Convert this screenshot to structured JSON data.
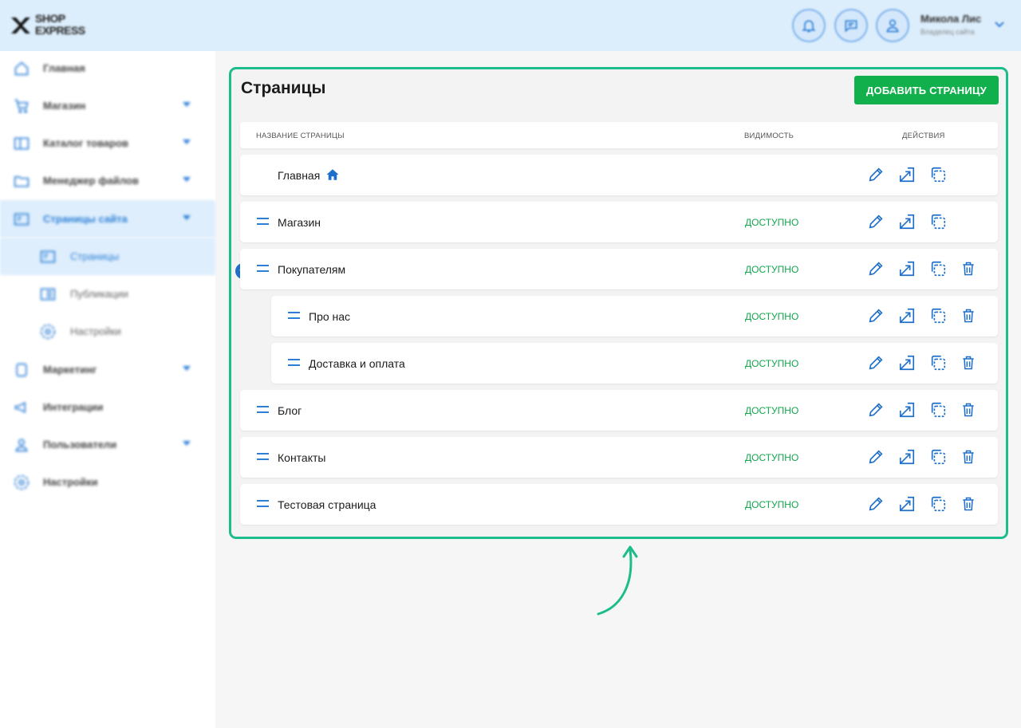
{
  "header": {
    "logo_line1": "SHOP",
    "logo_line2": "EXPRESS",
    "user_name": "Микола Лис",
    "user_role": "Владелец сайта",
    "icons": [
      "bell-icon",
      "chat-icon",
      "user-icon",
      "chevron-down-icon"
    ]
  },
  "sidebar": {
    "items": [
      {
        "label": "Главная",
        "icon": "home-icon"
      },
      {
        "label": "Магазин",
        "icon": "cart-icon"
      },
      {
        "label": "Каталог товаров",
        "icon": "catalog-icon"
      },
      {
        "label": "Менеджер файлов",
        "icon": "folder-icon"
      },
      {
        "label": "Страницы сайта",
        "icon": "pages-icon"
      },
      {
        "label": "Страницы",
        "icon": "page-icon"
      },
      {
        "label": "Публикации",
        "icon": "news-icon"
      },
      {
        "label": "Настройки",
        "icon": "gear-icon"
      },
      {
        "label": "Маркетинг",
        "icon": "marketing-icon"
      },
      {
        "label": "Интеграции",
        "icon": "megaphone-icon"
      },
      {
        "label": "Пользователи",
        "icon": "users-icon"
      },
      {
        "label": "Настройки",
        "icon": "gear-icon"
      }
    ]
  },
  "main": {
    "title": "Страницы",
    "add_button": "ДОБАВИТЬ СТРАНИЦУ",
    "columns": {
      "name": "НАЗВАНИЕ СТРАНИЦЫ",
      "visibility": "ВИДИМОСТЬ",
      "actions": "ДЕЙСТВИЯ"
    },
    "rows": [
      {
        "name": "Главная",
        "status": ""
      },
      {
        "name": "Магазин",
        "status": "ДОСТУПНО"
      },
      {
        "name": "Покупателям",
        "status": "ДОСТУПНО"
      },
      {
        "name": "Про нас",
        "status": "ДОСТУПНО"
      },
      {
        "name": "Доставка и оплата",
        "status": "ДОСТУПНО"
      },
      {
        "name": "Блог",
        "status": "ДОСТУПНО"
      },
      {
        "name": "Контакты",
        "status": "ДОСТУПНО"
      },
      {
        "name": "Тестовая страница",
        "status": "ДОСТУПНО"
      }
    ]
  },
  "colors": {
    "accent": "#2d7fd6",
    "success": "#12b04c",
    "highlight": "#1cbd8a"
  }
}
